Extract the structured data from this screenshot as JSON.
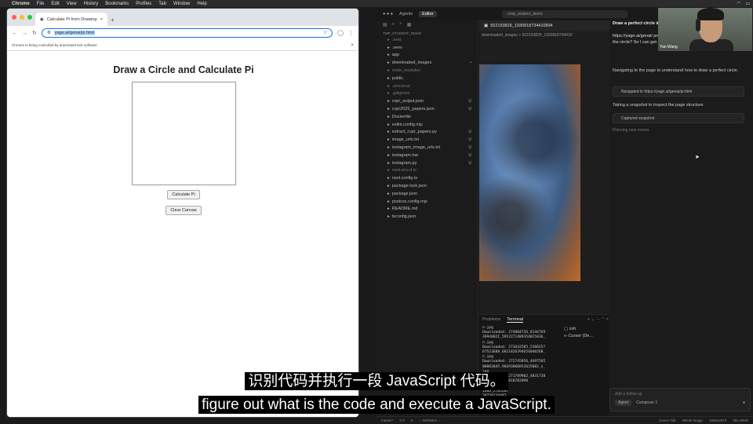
{
  "menubar": {
    "app": "Chrome",
    "items": [
      "File",
      "Edit",
      "View",
      "History",
      "Bookmarks",
      "Profiles",
      "Tab",
      "Window",
      "Help"
    ]
  },
  "browser": {
    "tab_title": "Calculate Pi from Drawing",
    "url_prefix": "yage.ai/genai/pi.html",
    "info_text": "Chrome is being controlled by automated test software",
    "page": {
      "heading": "Draw a Circle and Calculate Pi",
      "calc_button": "Calculate Pi",
      "clear_button": "Clear Canvas"
    }
  },
  "ide": {
    "top_tabs": [
      "Agents",
      "Editor"
    ],
    "search": "tmp_student_demo",
    "project": "TMP_STUDENT_DEMO",
    "files": [
      {
        "name": ".next",
        "dim": true,
        "badge": ""
      },
      {
        "name": ".venv",
        "dim": false,
        "badge": ""
      },
      {
        "name": "app",
        "dim": false,
        "badge": ""
      },
      {
        "name": "downloaded_images",
        "dim": false,
        "badge": "•"
      },
      {
        "name": "node_modules",
        "dim": true,
        "badge": ""
      },
      {
        "name": "public",
        "dim": false,
        "badge": ""
      },
      {
        "name": ".env.local",
        "dim": true,
        "badge": ""
      },
      {
        "name": ".gitignore",
        "dim": true,
        "badge": ""
      },
      {
        "name": "cvpr_output.json",
        "dim": false,
        "badge": "U"
      },
      {
        "name": "cvpr2025_papers.json",
        "dim": false,
        "badge": "U"
      },
      {
        "name": "Dockerfile",
        "dim": false,
        "badge": ""
      },
      {
        "name": "eslint.config.mjs",
        "dim": false,
        "badge": ""
      },
      {
        "name": "extract_cvpr_papers.py",
        "dim": false,
        "badge": "U"
      },
      {
        "name": "image_urls.txt",
        "dim": false,
        "badge": "U"
      },
      {
        "name": "instagram_image_urls.txt",
        "dim": false,
        "badge": "U"
      },
      {
        "name": "instagram.har",
        "dim": false,
        "badge": "U"
      },
      {
        "name": "instagram.py",
        "dim": false,
        "badge": "U"
      },
      {
        "name": "next-env.d.ts",
        "dim": true,
        "badge": ""
      },
      {
        "name": "next.config.ts",
        "dim": false,
        "badge": ""
      },
      {
        "name": "package-lock.json",
        "dim": false,
        "badge": ""
      },
      {
        "name": "package.json",
        "dim": false,
        "badge": ""
      },
      {
        "name": "postcss.config.mjs",
        "dim": false,
        "badge": ""
      },
      {
        "name": "README.md",
        "dim": false,
        "badge": ""
      },
      {
        "name": "tsconfig.json",
        "dim": false,
        "badge": ""
      }
    ],
    "editor_tab": "502153829_1930918734410894",
    "breadcrumb": "downloaded_images > 502153829_1930918734410",
    "terminal": {
      "tabs": [
        "Problems",
        "Terminal"
      ],
      "lines": "n.jpg\nDownloaded: 274804736_8144769\n3994082I_59522714893548I5836_\nn.jpg\nDownloaded: 273642505_5360257\n67523688_682182639465404026B_\nn.jpg\nDownloaded: 272745856_4697585\n08083045_96693860853625082_n_\njpg\nDownloaded: 271709902_4831738\n0513886_3398818782098\n\n1406_2785207\n30739134497_",
      "sessions": [
        "zsh",
        "Cursor (De..."
      ]
    }
  },
  "chat": {
    "title": "Draw a perfect circle in...",
    "user_msg": "https://yage.ai/genai/ program to run in the circle? So I can get a...",
    "step1": "Navigating to the page to understand how to draw a perfect circle.",
    "tool1": "Navigated to https://yage.ai/genai/pi.html",
    "step2": "Taking a snapshot to inspect the page structure:",
    "tool2": "Captured snapshot",
    "planning": "Planning next moves",
    "followup_placeholder": "Add a follow-up",
    "mode": "Agent",
    "model": "Composer 1"
  },
  "webcam": {
    "name": "Yan Wang"
  },
  "statusbar": {
    "left": [
      "master*",
      "0 0",
      "0",
      "-- NORMAL --"
    ],
    "right": [
      "Cursor Tab",
      "Whole image",
      "1006x2870",
      "381.09KB"
    ]
  },
  "subtitles": {
    "cn": "识别代码并执行一段 JavaScript 代码。",
    "en": "figure out what is the code and execute a JavaScript."
  },
  "colors": {
    "accent": "#1a73e8",
    "red": "#ff5f57",
    "yellow": "#febc2e",
    "green": "#28c840"
  }
}
